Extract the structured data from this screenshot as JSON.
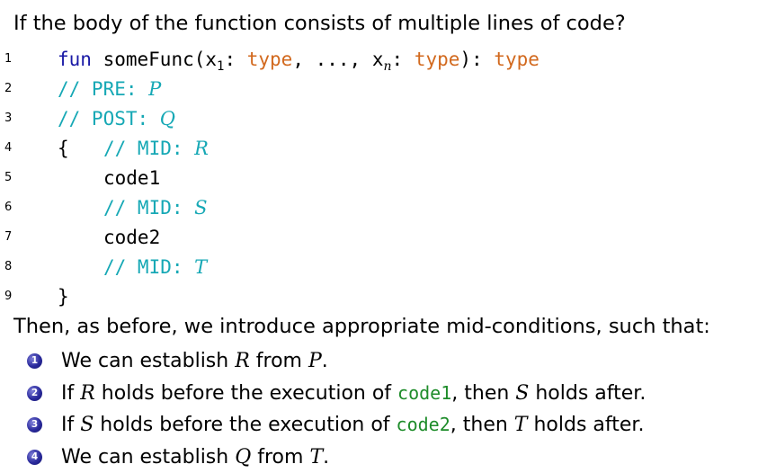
{
  "heading": "If the body of the function consists of multiple lines of code?",
  "code": {
    "line_numbers": [
      "1",
      "2",
      "3",
      "4",
      "5",
      "6",
      "7",
      "8",
      "9"
    ],
    "l1": {
      "kw": "fun",
      "name": " someFunc(x",
      "sub1": "1",
      "colon1": ": ",
      "type1": "type",
      "mid": ", ..., x",
      "subn": "n",
      "colon2": ": ",
      "type2": "type",
      "close": "): ",
      "type3": "type"
    },
    "l2": {
      "comment": "// PRE: ",
      "var": "P"
    },
    "l3": {
      "comment": "// POST: ",
      "var": "Q"
    },
    "l4": {
      "brace": "{",
      "comment": "// MID: ",
      "var": "R"
    },
    "l5": {
      "code": "code1"
    },
    "l6": {
      "comment": "// MID: ",
      "var": "S"
    },
    "l7": {
      "code": "code2"
    },
    "l8": {
      "comment": "// MID: ",
      "var": "T"
    },
    "l9": {
      "brace": "}"
    }
  },
  "para": "Then, as before, we introduce appropriate mid-conditions, such that:",
  "items": [
    {
      "num": "1",
      "t1": "We can establish ",
      "v1": "R",
      "t2": " from ",
      "v2": "P",
      "t3": "."
    },
    {
      "num": "2",
      "t1": "If ",
      "v1": "R",
      "t2": " holds before the execution of ",
      "code": "code1",
      "t3": ", then ",
      "v2": "S",
      "t4": " holds after."
    },
    {
      "num": "3",
      "t1": "If ",
      "v1": "S",
      "t2": " holds before the execution of ",
      "code": "code2",
      "t3": ", then ",
      "v2": "T",
      "t4": " holds after."
    },
    {
      "num": "4",
      "t1": "We can establish ",
      "v1": "Q",
      "t2": " from ",
      "v2": "T",
      "t3": "."
    }
  ]
}
